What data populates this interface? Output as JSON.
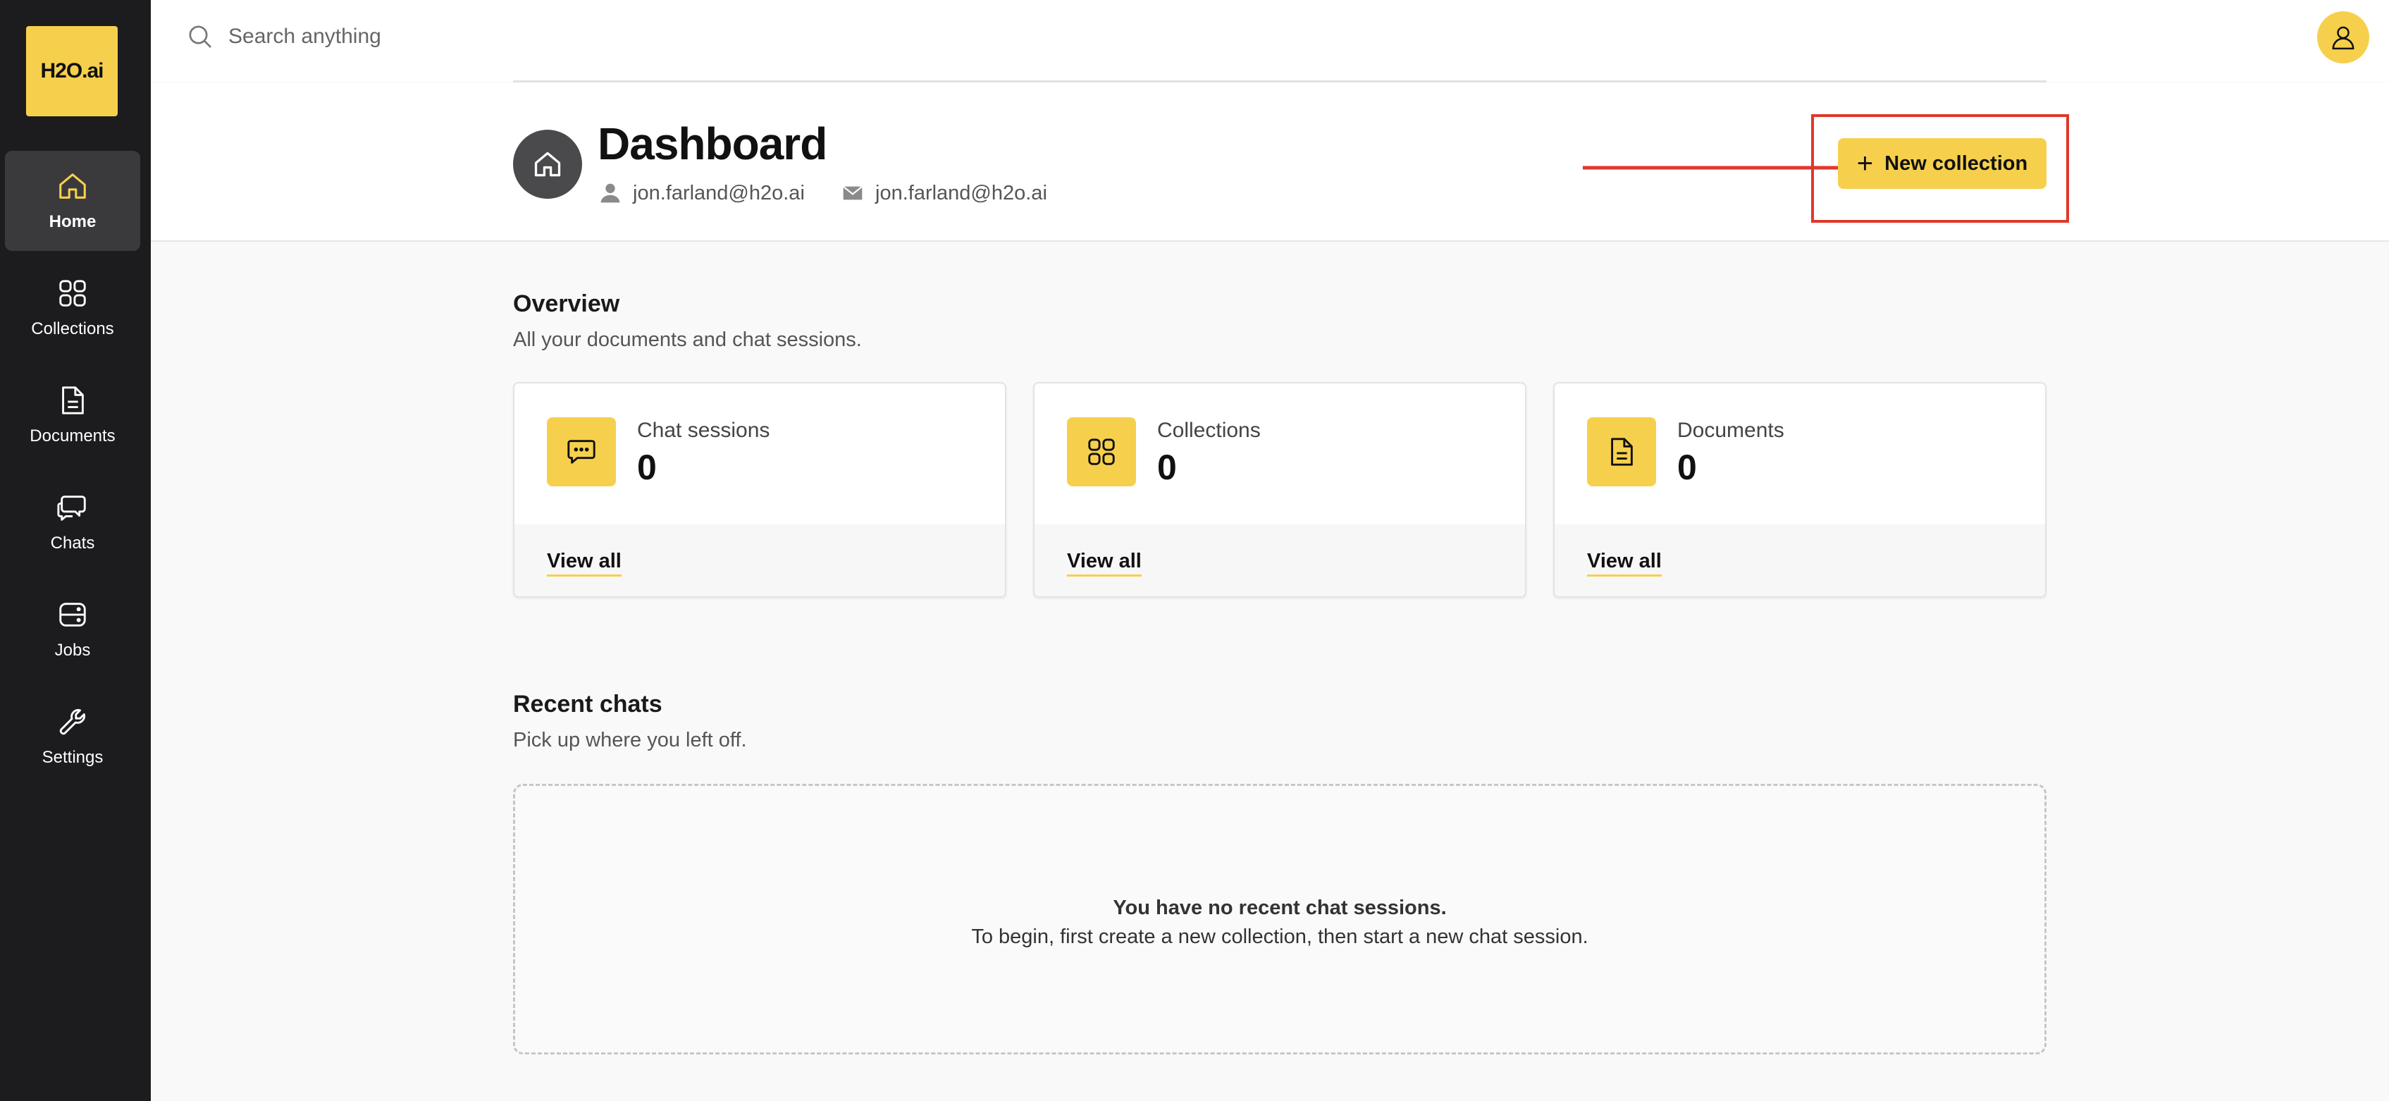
{
  "brand": {
    "logo_text": "H2O.ai",
    "accent_color": "#f6d04d",
    "sidebar_color": "#1c1c1e"
  },
  "sidebar": {
    "items": [
      {
        "label": "Home",
        "icon": "home-icon",
        "active": true
      },
      {
        "label": "Collections",
        "icon": "grid-icon",
        "active": false
      },
      {
        "label": "Documents",
        "icon": "document-icon",
        "active": false
      },
      {
        "label": "Chats",
        "icon": "chat-bubbles-icon",
        "active": false
      },
      {
        "label": "Jobs",
        "icon": "server-icon",
        "active": false
      },
      {
        "label": "Settings",
        "icon": "wrench-icon",
        "active": false
      }
    ]
  },
  "search": {
    "placeholder": "Search anything",
    "value": ""
  },
  "header": {
    "title": "Dashboard",
    "username": "jon.farland@h2o.ai",
    "email": "jon.farland@h2o.ai",
    "new_collection_label": "New collection",
    "highlight_color": "#e0382b"
  },
  "overview": {
    "title": "Overview",
    "subtitle": "All your documents and chat sessions.",
    "cards": [
      {
        "label": "Chat sessions",
        "count": "0",
        "link": "View all",
        "icon": "chat-icon"
      },
      {
        "label": "Collections",
        "count": "0",
        "link": "View all",
        "icon": "grid-icon"
      },
      {
        "label": "Documents",
        "count": "0",
        "link": "View all",
        "icon": "document-icon"
      }
    ]
  },
  "recent_chats": {
    "title": "Recent chats",
    "subtitle": "Pick up where you left off.",
    "empty_title": "You have no recent chat sessions.",
    "empty_text": "To begin, first create a new collection, then start a new chat session."
  }
}
